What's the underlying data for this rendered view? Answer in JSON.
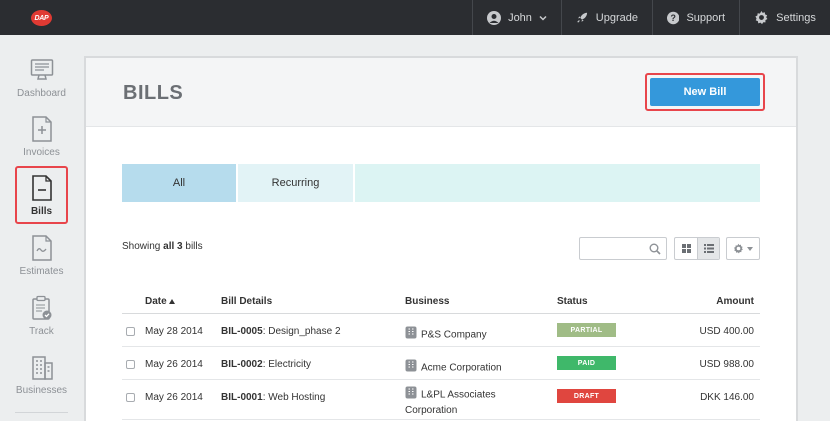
{
  "app": {
    "logo_text": "DAP"
  },
  "topnav": {
    "user_label": "John",
    "upgrade_label": "Upgrade",
    "support_label": "Support",
    "settings_label": "Settings"
  },
  "sidebar": {
    "items": [
      {
        "label": "Dashboard",
        "icon": "monitor-icon"
      },
      {
        "label": "Invoices",
        "icon": "invoice-plus-icon"
      },
      {
        "label": "Bills",
        "icon": "bill-minus-icon",
        "active": true
      },
      {
        "label": "Estimates",
        "icon": "estimate-chart-icon"
      },
      {
        "label": "Track",
        "icon": "clipboard-check-icon"
      },
      {
        "label": "Businesses",
        "icon": "building-icon"
      }
    ]
  },
  "page": {
    "title": "BILLS",
    "new_bill_label": "New Bill",
    "tabs": [
      {
        "label": "All",
        "active": true
      },
      {
        "label": "Recurring",
        "active": false
      }
    ],
    "showing_prefix": "Showing ",
    "showing_count": "all 3",
    "showing_suffix": " bills",
    "search_placeholder": ""
  },
  "table": {
    "columns": {
      "date": "Date",
      "bill_details": "Bill Details",
      "business": "Business",
      "status": "Status",
      "amount": "Amount"
    },
    "rows": [
      {
        "date": "May 28 2014",
        "bill_id": "BIL-0005",
        "bill_desc": ": Design_phase 2",
        "business": "P&S Company",
        "status": "PARTIAL",
        "status_color": "#a0bc86",
        "amount": "USD 400.00"
      },
      {
        "date": "May 26 2014",
        "bill_id": "BIL-0002",
        "bill_desc": ": Electricity",
        "business": "Acme Corporation",
        "status": "PAID",
        "status_color": "#3fb86a",
        "amount": "USD 988.00"
      },
      {
        "date": "May 26 2014",
        "bill_id": "BIL-0001",
        "bill_desc": ": Web Hosting",
        "business": "L&PL Associates Corporation",
        "status": "DRAFT",
        "status_color": "#e0463f",
        "amount": "DKK 146.00"
      }
    ]
  },
  "colors": {
    "topbar": "#2b2d31",
    "accent": "#3498db",
    "highlight": "#e8454b",
    "tab_active": "#b6dced"
  }
}
